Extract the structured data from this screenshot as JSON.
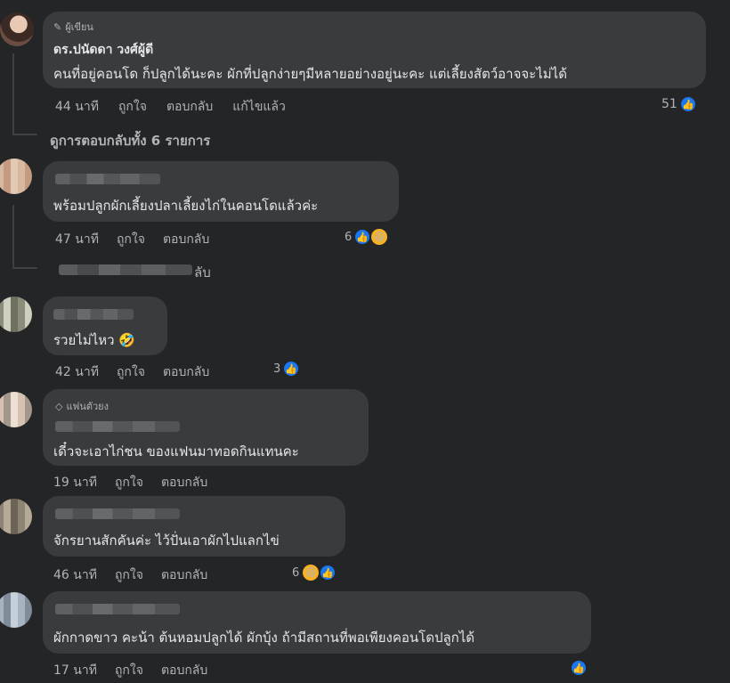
{
  "colors": {
    "background": "#242526",
    "bubble": "#3a3b3c",
    "text": "#e4e6eb",
    "muted": "#b0b3b8",
    "like_blue": "#1877f2",
    "haha_yellow": "#f7b125"
  },
  "top_comment": {
    "badge": "ผู้เขียน",
    "badge_icon": "pencil-icon",
    "author": "ดร.ปนัดดา วงศ์ผู้ดี",
    "text": "คนที่อยู่คอนโด ก็ปลูกได้นะคะ ผักที่ปลูกง่ายๆมีหลายอย่างอยู่นะคะ แต่เลี้ยงสัตว์อาจจะไม่ได้",
    "time": "44 นาที",
    "like": "ถูกใจ",
    "reply": "ตอบกลับ",
    "edited": "แก้ไขแล้ว",
    "reaction_count": "51",
    "view_replies": "ดูการตอบกลับทั้ง 6 รายการ"
  },
  "comments": [
    {
      "text": "พร้อมปลูกผักเลี้ยงปลาเลี้ยงไก่ในคอนโดแล้วค่ะ",
      "time": "47 นาที",
      "like": "ถูกใจ",
      "reply": "ตอบกลับ",
      "reaction_count": "6",
      "reactions": [
        "like",
        "haha"
      ],
      "reply_row_text": "ลับ"
    },
    {
      "text": "รวยไม่ไหว 🤣",
      "time": "42 นาที",
      "like": "ถูกใจ",
      "reply": "ตอบกลับ",
      "reaction_count": "3",
      "reactions": [
        "like"
      ]
    },
    {
      "badge": "แฟนตัวยง",
      "badge_icon": "diamond-icon",
      "text": "เดี๋วจะเอาไก่ชน ของแฟนมาทอดกินแทนคะ",
      "time": "19 นาที",
      "like": "ถูกใจ",
      "reply": "ตอบกลับ"
    },
    {
      "text": "จักรยานสักคันค่ะ ไว้ปั่นเอาผักไปแลกไข่",
      "time": "46 นาที",
      "like": "ถูกใจ",
      "reply": "ตอบกลับ",
      "reaction_count": "6",
      "reactions": [
        "haha",
        "like"
      ]
    },
    {
      "text": "ผักกาดขาว คะน้า ต้นหอมปลูกได้ ผักบุ้ง ถ้ามีสถานที่พอเพียงคอนโดปลูกได้",
      "time": "17 นาที",
      "like": "ถูกใจ",
      "reply": "ตอบกลับ",
      "reactions": [
        "like"
      ]
    }
  ]
}
